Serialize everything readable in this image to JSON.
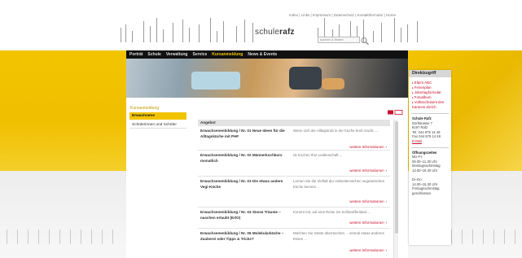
{
  "header": {
    "toplinks": [
      "Index",
      "Links",
      "Impressum",
      "Datenschutz",
      "Kontaktformular",
      "Home"
    ],
    "logo_prefix": "schule",
    "logo_suffix": "rafz",
    "search_placeholder": "suchen & finden"
  },
  "nav": {
    "items": [
      "Porträt",
      "Schule",
      "Verwaltung",
      "Service",
      "Kursanmeldung",
      "News & Events"
    ],
    "active": "Kursanmeldung"
  },
  "sidebar": {
    "heading": "Kursanmeldung",
    "items": [
      {
        "label": "Erwachsene",
        "active": true
      },
      {
        "label": "Schülerinnen und Schüler",
        "active": false
      }
    ]
  },
  "table": {
    "header": "Angebot",
    "more_label": "weitere Informationen",
    "rows": [
      {
        "title": "Erwachsenenbildung / Nr. 01 Neue Ideen für die Alltagsküche mit PHF",
        "desc": "Wenn sich der Alltagstrott in der Küche breit macht, ..."
      },
      {
        "title": "Erwachsenenbildung / Nr. 02 Männerkochkurs monatlich",
        "desc": "Ist Kochen Ihre Leidenschaft ..."
      },
      {
        "title": "Erwachsenenbildung / Nr. 03 Die etwas andere Vegi-Küche",
        "desc": "Lernen Sie die Vielfalt der vielseitemsichen vegetarischen Küche kennen ..."
      },
      {
        "title": "Erwachsenenbildung / Nr. 04 Süsse Träume – naschen erlaubt (ErlO)",
        "desc": "Kommt mit, auf eine Reise ins Schlaraffenland ..."
      },
      {
        "title": "Erwachsenenbildung / Nr. 06 Molekularküche – Zauberei oder Tipps & Tricks?",
        "desc": "Möchten Sie Gäste überraschen ... einmal etwas anderes Essen ..."
      }
    ]
  },
  "direktzugriff": {
    "heading": "Direktzugriff",
    "links": [
      "Eltern ABC",
      "Ferienplan",
      "Jokertagformular",
      "Fotoalbum",
      "Volksschulamt des Kantons Zürich"
    ],
    "address": {
      "name": "Schule Rafz",
      "street": "Dorfstrasse 7",
      "city": "8197 Rafz",
      "tel": "Tel. 044 879 14 49",
      "fax": "Fax 044 879 14 48",
      "email": "E-Mail"
    },
    "hours": {
      "heading": "Öffnungszeiten",
      "lines": [
        "Mo–Fr:",
        "08.00–11.30 Uhr",
        "Montagnachmittag:",
        "14.00–16.30 Uhr",
        "",
        "Di–Do:",
        "14.00–16.30 Uhr",
        "Freitagnachmittag",
        "geschlossen"
      ]
    }
  },
  "colors": {
    "accent_yellow": "#f2c400",
    "link_red": "#c8102e",
    "nav_bg": "#111111"
  }
}
